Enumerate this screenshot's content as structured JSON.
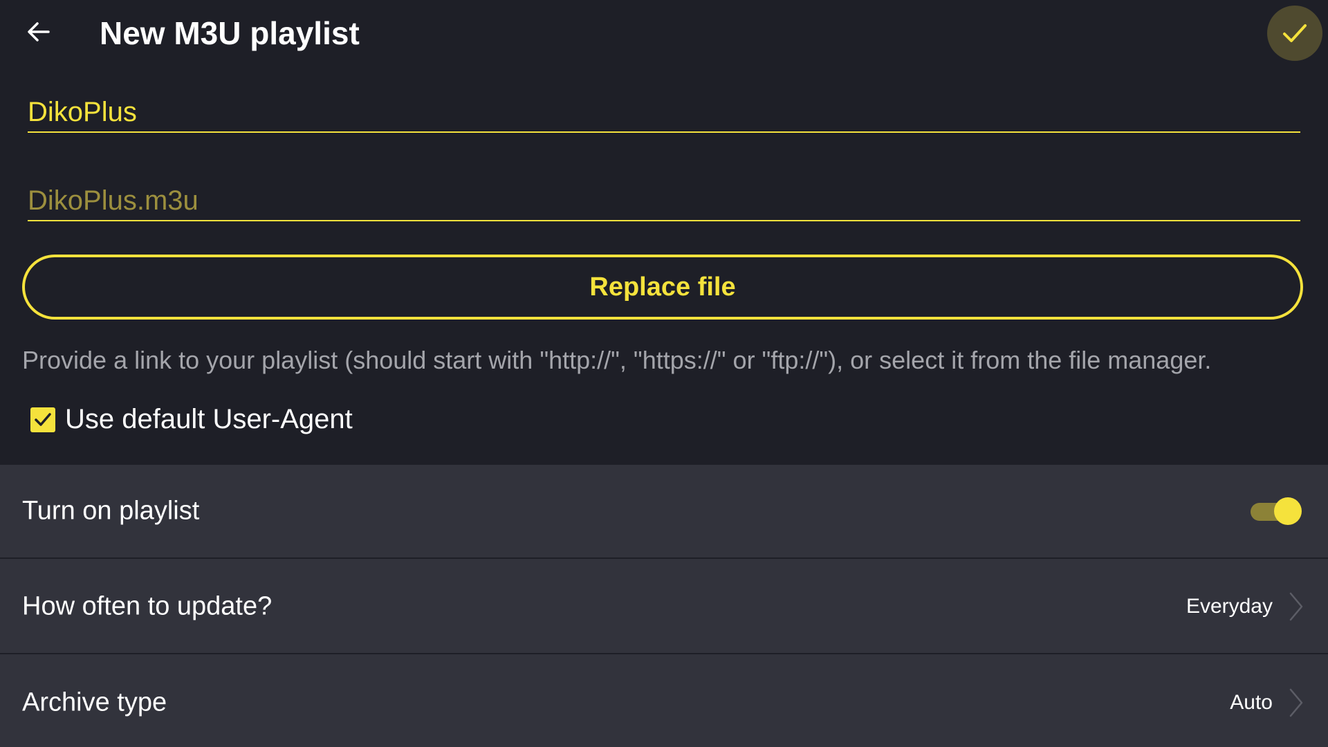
{
  "header": {
    "title": "New M3U playlist",
    "back_icon": "arrow-left-icon",
    "confirm_icon": "check-icon"
  },
  "form": {
    "name_value": "DikoPlus",
    "file_placeholder": "DikoPlus.m3u",
    "replace_button_label": "Replace file",
    "hint": "Provide a link to your playlist (should start with \"http://\", \"https://\" or \"ftp://\"), or select it from the file manager.",
    "user_agent_label": "Use default User-Agent",
    "user_agent_checked": true
  },
  "settings": {
    "turn_on": {
      "label": "Turn on playlist",
      "enabled": true
    },
    "update": {
      "label": "How often to update?",
      "value": "Everyday"
    },
    "archive": {
      "label": "Archive type",
      "value": "Auto"
    }
  },
  "colors": {
    "accent": "#f5e23c",
    "background": "#1e1f27",
    "list_background": "#32333c",
    "hint_text": "#a4a5ab"
  }
}
